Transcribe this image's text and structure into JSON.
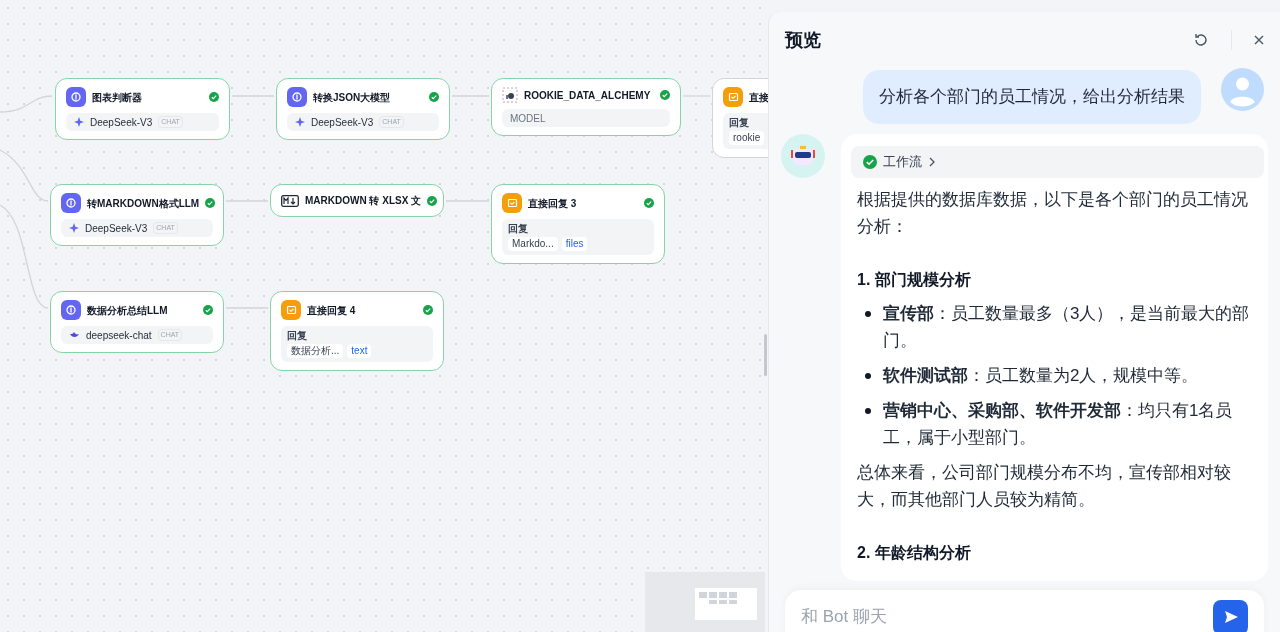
{
  "canvas": {
    "nodes": [
      {
        "kind": "llm",
        "title": "图表判断器",
        "ok": true,
        "model": "DeepSeek-V3",
        "tag": "CHAT"
      },
      {
        "kind": "llm",
        "title": "转换JSON大模型",
        "ok": true,
        "model": "DeepSeek-V3",
        "tag": "CHAT"
      },
      {
        "kind": "plugin",
        "title": "ROOKIE_DATA_ALCHEMY",
        "ok": true,
        "model": "MODEL"
      },
      {
        "kind": "reply",
        "title": "直接",
        "ok": false,
        "field_label": "回复",
        "chips": [
          "rookie"
        ]
      },
      {
        "kind": "llm",
        "title": "转MARKDOWN格式LLM",
        "ok": true,
        "model": "DeepSeek-V3",
        "tag": "CHAT"
      },
      {
        "kind": "tool",
        "title": "MARKDOWN 转 XLSX 文",
        "ok": true
      },
      {
        "kind": "reply",
        "title": "直接回复 3",
        "ok": true,
        "field_label": "回复",
        "chips": [
          "Markdo...",
          "files"
        ]
      },
      {
        "kind": "llm",
        "title": "数据分析总结LLM",
        "ok": true,
        "model": "deepseek-chat",
        "tag": "CHAT",
        "whale": true
      },
      {
        "kind": "reply",
        "title": "直接回复 4",
        "ok": true,
        "field_label": "回复",
        "chips": [
          "数据分析...",
          "text"
        ]
      }
    ]
  },
  "preview": {
    "title": "预览",
    "user_message": "分析各个部门的员工情况，给出分析结果",
    "workflow": {
      "label": "工作流",
      "done": true
    },
    "blocks": [
      {
        "kind": "para",
        "text": "根据提供的数据库数据，以下是各个部门的员工情况分析："
      },
      {
        "kind": "heading",
        "text": "1. 部门规模分析"
      },
      {
        "kind": "bullet",
        "text": "**宣传部**：员工数量最多（3人），是当前最大的部门。"
      },
      {
        "kind": "bullet",
        "text": "**软件测试部**：员工数量为2人，规模中等。"
      },
      {
        "kind": "bullet",
        "text": "**营销中心、采购部、软件开发部**：均只有1名员工，属于小型部门。"
      },
      {
        "kind": "para",
        "text": "总体来看，公司部门规模分布不均，宣传部相对较大，而其他部门人员较为精简。"
      },
      {
        "kind": "heading",
        "text": "2. 年龄结构分析"
      }
    ],
    "input": {
      "placeholder": "和 Bot 聊天"
    }
  }
}
